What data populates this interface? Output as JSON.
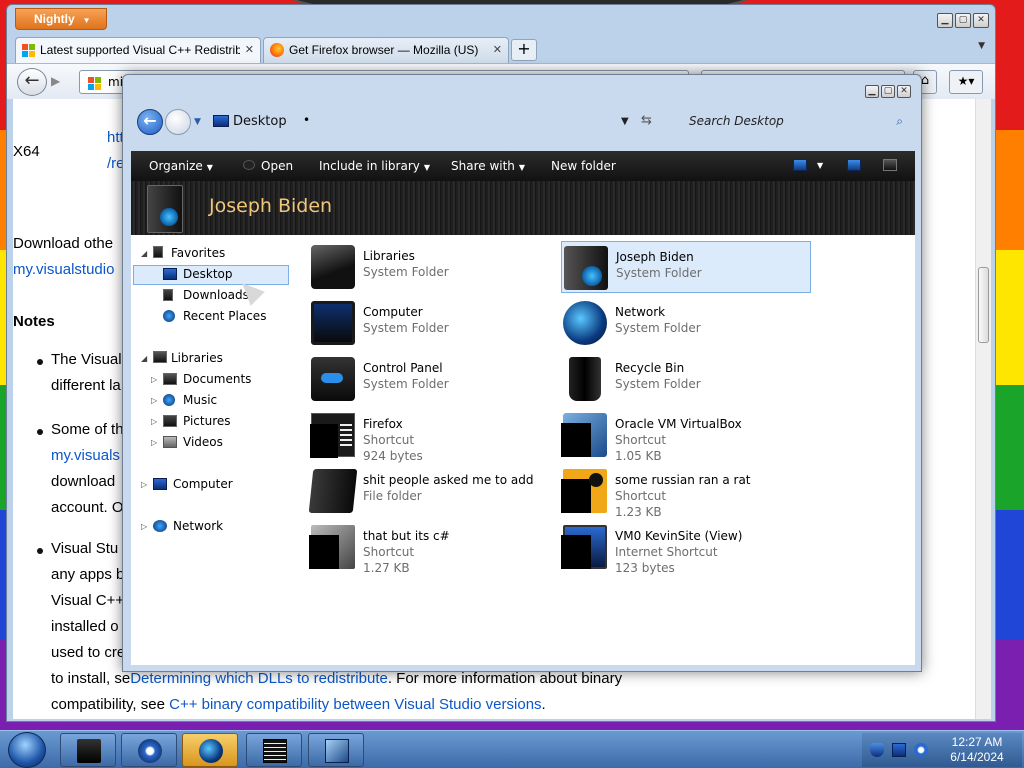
{
  "browser": {
    "menu_button": "Nightly",
    "tabs": [
      {
        "title": "Latest supported Visual C++ Redistrib...",
        "close": "✕"
      },
      {
        "title": "Get Firefox browser — Mozilla (US)",
        "close": "✕"
      }
    ],
    "new_tab": "+",
    "url_text": "mic",
    "search_text": "",
    "page": {
      "row_label": "X64",
      "link_top_1": "htt",
      "link_top_2": "/re",
      "download_line": "Download othe",
      "download_link": "my.visualstudio",
      "notes_heading": "Notes",
      "bullet1_line1": "The Visual",
      "bullet1_line2": "different la",
      "bullet2_line1": "Some of th",
      "bullet2_link": "my.visuals",
      "bullet2_line3": "download",
      "bullet2_line4": "account. O",
      "bullet3_line1": "Visual Stu",
      "bullet3_line2": "any apps b",
      "bullet3_line3": "Visual C++",
      "bullet3_line4": "installed o",
      "bullet3_line5": "used to cre",
      "bullet3_line6_prefix": "to install, se",
      "bullet3_line6_link": "Determining which DLLs to redistribute",
      "bullet3_line6_suffix": ". For more information about binary",
      "bullet3_line7_prefix": "compatibility, see ",
      "bullet3_line7_link": "C++ binary compatibility between Visual Studio versions",
      "bullet3_line7_suffix": "."
    }
  },
  "explorer": {
    "location": "Desktop",
    "search_placeholder": "Search Desktop",
    "toolbar": {
      "organize": "Organize",
      "open": "Open",
      "include_in_library": "Include in library",
      "share_with": "Share with",
      "new_folder": "New folder"
    },
    "banner_title": "Joseph Biden",
    "nav": {
      "favorites": "Favorites",
      "desktop": "Desktop",
      "downloads": "Downloads",
      "recent_places": "Recent Places",
      "libraries": "Libraries",
      "documents": "Documents",
      "music": "Music",
      "pictures": "Pictures",
      "videos": "Videos",
      "computer": "Computer",
      "network": "Network"
    },
    "items": [
      {
        "name": "Libraries",
        "type": "System Folder",
        "size": ""
      },
      {
        "name": "Joseph Biden",
        "type": "System Folder",
        "size": ""
      },
      {
        "name": "Computer",
        "type": "System Folder",
        "size": ""
      },
      {
        "name": "Network",
        "type": "System Folder",
        "size": ""
      },
      {
        "name": "Control Panel",
        "type": "System Folder",
        "size": ""
      },
      {
        "name": "Recycle Bin",
        "type": "System Folder",
        "size": ""
      },
      {
        "name": "Firefox",
        "type": "Shortcut",
        "size": "924 bytes"
      },
      {
        "name": "Oracle VM VirtualBox",
        "type": "Shortcut",
        "size": "1.05 KB"
      },
      {
        "name": "shit people asked me to add",
        "type": "File folder",
        "size": ""
      },
      {
        "name": "some russian ran a rat",
        "type": "Shortcut",
        "size": "1.23 KB"
      },
      {
        "name": "that but its c#",
        "type": "Shortcut",
        "size": "1.27 KB"
      },
      {
        "name": "VM0 KevinSite (View)",
        "type": "Internet Shortcut",
        "size": "123 bytes"
      }
    ]
  },
  "taskbar": {
    "time": "12:27 AM",
    "date": "6/14/2024"
  },
  "colors": {
    "accent_orange": "#e0731c",
    "link_blue": "#0b57c9",
    "banner_title": "#f0c77a",
    "selection": "#dcebfc"
  }
}
